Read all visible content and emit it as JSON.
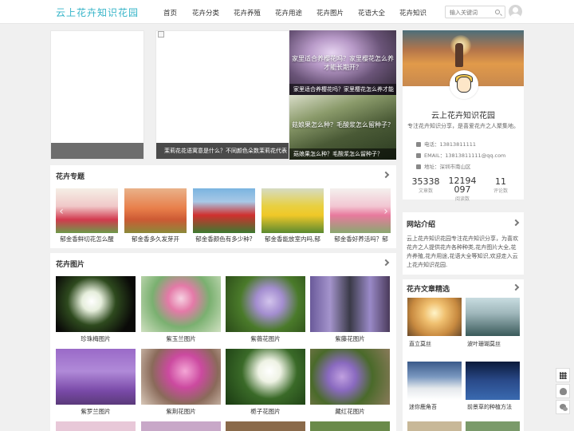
{
  "header": {
    "logo": "云上花卉知识花园",
    "nav": [
      "首页",
      "花卉分类",
      "花卉养殖",
      "花卉用途",
      "花卉图片",
      "花语大全",
      "花卉知识"
    ],
    "search_placeholder": "输入关键词"
  },
  "slider": {
    "main_caption": "茉莉花花语寓意是什么？不同颜色朵数茉莉花代表",
    "side": [
      {
        "overlay": "家里适合养樱花吗？家里樱花怎么养才能长期开？",
        "caption": "家里适合养樱花吗？家里樱花怎么养才能"
      },
      {
        "overlay": "菇娘果怎么种？毛酸浆怎么留种子？",
        "caption": "菇娘果怎么种？毛酸浆怎么留种子？"
      }
    ]
  },
  "topics": {
    "title": "花卉专题",
    "items": [
      "郁金香鲜切花怎么醒",
      "郁金香多久发芽开",
      "郁金香颜色有多少种?",
      "郁金香能放室内吗,郁",
      "郁金香好养活吗？郁"
    ]
  },
  "pictures": {
    "title": "花卉图片",
    "items": [
      "珍珠梅图片",
      "紫玉兰图片",
      "紫薇花图片",
      "紫藤花图片",
      "紫罗兰图片",
      "紫荆花图片",
      "栀子花图片",
      "藏红花图片"
    ]
  },
  "profile": {
    "name": "云上花卉知识花园",
    "desc": "专注花卉知识分享，是喜爱花卉之人聚集地。",
    "phone": "电话：13813811111",
    "email": "EMAIL：13813811111@qq.com",
    "address": "地址：深圳市南山区",
    "stats": [
      {
        "num": "35338",
        "label": "文章数"
      },
      {
        "num": "12194097",
        "label": "阅读数"
      },
      {
        "num": "11",
        "label": "评论数"
      }
    ]
  },
  "intro": {
    "title": "网站介绍",
    "text": "云上花卉知识花园专注花卉知识分享，为喜欢花卉之人提供花卉各种种类,花卉图片大全,花卉养殖,花卉用途,花语大全等知识,欢迎走入云上花卉知识花园."
  },
  "essence": {
    "title": "花卉文章精选",
    "items": [
      "直立莫丝",
      "波叶珊瑚莫丝",
      "迷你鹿角苔",
      "前景草的种植方法"
    ]
  },
  "colors": {
    "accent": "#36b4c8"
  }
}
